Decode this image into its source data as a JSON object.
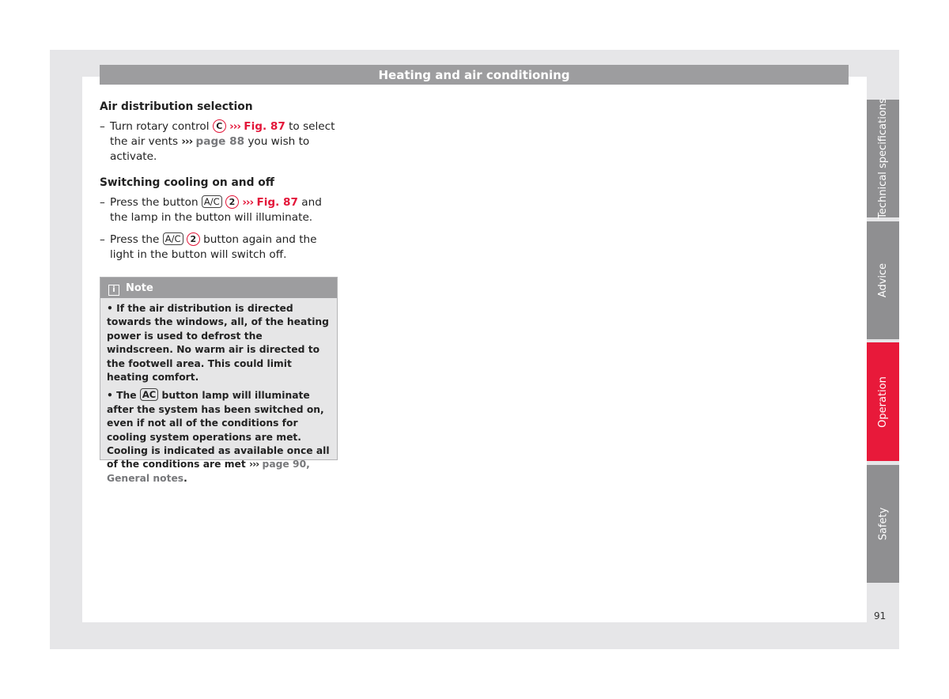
{
  "header": {
    "title": "Heating and air conditioning"
  },
  "sections": [
    {
      "heading": "Air distribution selection",
      "items": [
        {
          "dash": "–",
          "parts": [
            "Turn rotary control ",
            "C",
            " ",
            "›››",
            " ",
            "Fig. 87",
            " to select the air vents ",
            "›››",
            " ",
            "page 88",
            " you wish to activate."
          ]
        }
      ]
    },
    {
      "heading": "Switching cooling on and off",
      "items": [
        {
          "dash": "–",
          "parts": [
            "Press the button ",
            "A/C",
            " ",
            "2",
            " ",
            "›››",
            " ",
            "Fig. 87",
            " and the lamp in the button will illuminate."
          ]
        },
        {
          "dash": "–",
          "parts": [
            "Press the ",
            "A/C",
            " ",
            "2",
            " button again and the light in the button will switch off."
          ]
        }
      ]
    }
  ],
  "note": {
    "title": "Note",
    "icon": "info-icon",
    "p1": "• If the air distribution is directed towards the windows, all, of the heating power is used to defrost the windscreen. No warm air is directed to the footwell area. This could limit heating comfort.",
    "p2": [
      "• The ",
      "AC",
      " button lamp will illuminate after the system has been switched on, even if not all of the conditions for cooling system operations are met. Cooling is indicated as available once all of the conditions are met ",
      "›››",
      " ",
      "page 90, General notes",
      "."
    ]
  },
  "tabs": [
    {
      "label": "Technical specifications",
      "active": false
    },
    {
      "label": "Advice",
      "active": false
    },
    {
      "label": "Operation",
      "active": true
    },
    {
      "label": "Safety",
      "active": false
    }
  ],
  "page_number": "91",
  "colors": {
    "accent": "#e3173a",
    "tab_gray": "#8f8f91",
    "header_gray": "#9d9d9f",
    "frame": "#e6e6e8"
  }
}
